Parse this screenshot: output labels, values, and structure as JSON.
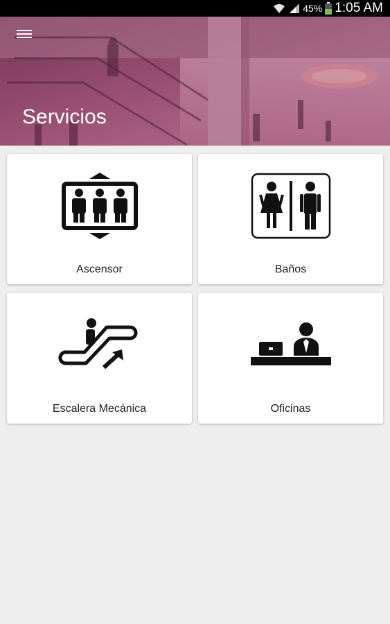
{
  "status_bar": {
    "battery": "45%",
    "time": "1:05 AM"
  },
  "header": {
    "title": "Servicios",
    "overlay_color": "#8a3a63"
  },
  "services": [
    {
      "label": "Ascensor",
      "icon": "elevator-icon"
    },
    {
      "label": "Baños",
      "icon": "restroom-icon"
    },
    {
      "label": "Escalera Mecánica",
      "icon": "escalator-icon"
    },
    {
      "label": "Oficinas",
      "icon": "office-icon"
    }
  ]
}
